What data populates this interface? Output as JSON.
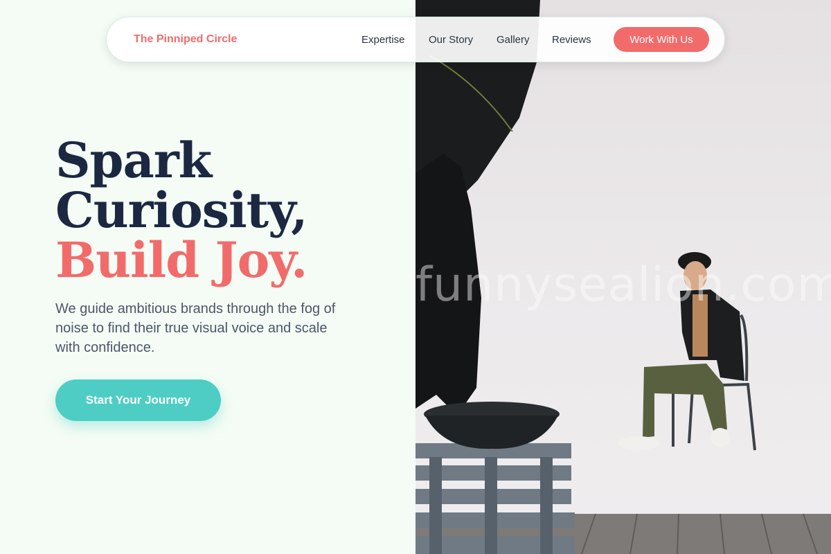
{
  "nav": {
    "logo": "The Pinniped Circle",
    "links": [
      "Expertise",
      "Our Story",
      "Gallery",
      "Reviews"
    ],
    "cta": "Work With Us"
  },
  "hero": {
    "headline_line1": "Spark",
    "headline_line2": "Curiosity,",
    "headline_accent": "Build Joy.",
    "subtitle": "We guide ambitious brands through the fog of noise to find their true visual voice and scale with confidence.",
    "cta": "Start Your Journey"
  },
  "photo": {
    "watermark": "funnysealion.com"
  },
  "colors": {
    "accent": "#f26b6b",
    "teal": "#4ecdc4",
    "navy": "#1c2842",
    "background": "#f4fcf5"
  }
}
